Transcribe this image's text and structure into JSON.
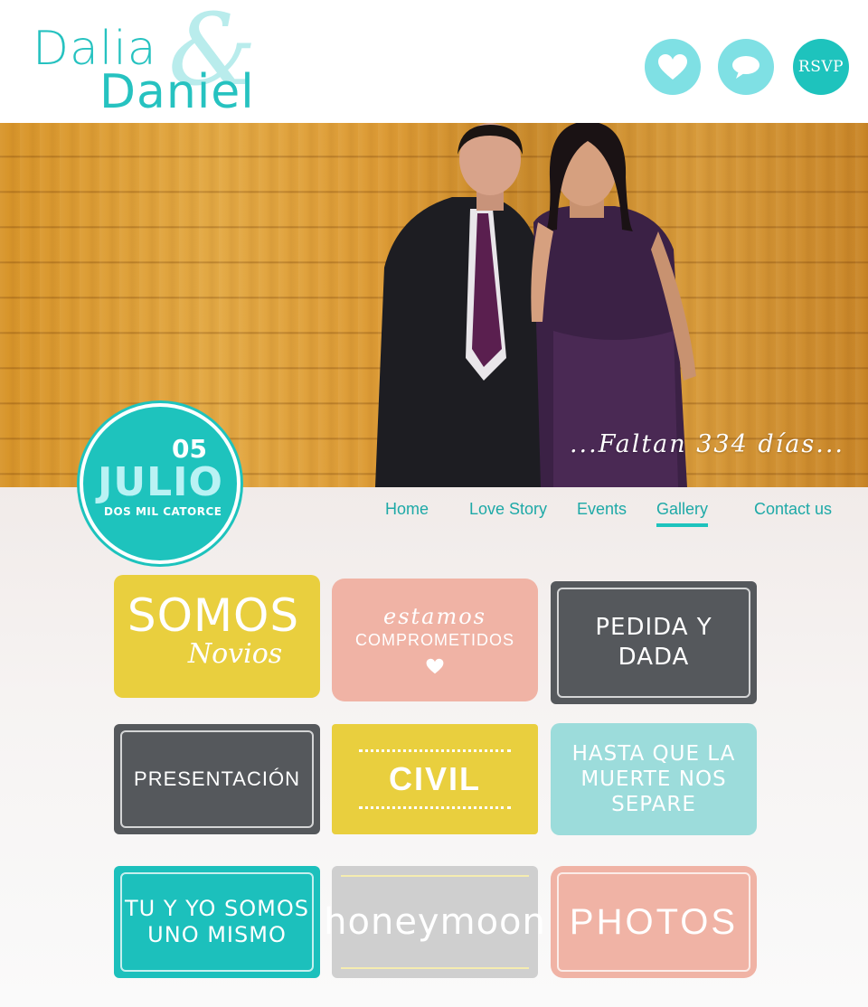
{
  "header": {
    "logo_line1": "Dalia",
    "logo_amp": "&",
    "logo_line2": "Daniel",
    "rsvp_label": "RSVP"
  },
  "hero": {
    "countdown": "...Faltan 334 días..."
  },
  "date_badge": {
    "day": "05",
    "month": "JULIO",
    "year": "DOS MIL CATORCE"
  },
  "nav": {
    "items": [
      "Home",
      "Love Story",
      "Events",
      "Gallery",
      "Contact us"
    ],
    "active": "Gallery"
  },
  "gallery": {
    "somos": "SOMOS",
    "novios": "Novios",
    "estamos": "estamos",
    "comprometidos": "COMPROMETIDOS",
    "pedida_1": "PEDIDA Y",
    "pedida_2": "DADA",
    "presentacion": "PRESENTACIÓN",
    "civil": "CIVIL",
    "hasta_1": "HASTA QUE LA",
    "hasta_2": "MUERTE NOS",
    "hasta_3": "SEPARE",
    "tu_1": "TU Y YO SOMOS",
    "tu_2": "UNO MISMO",
    "honeymoon": "honeymoon",
    "photos": "PHOTOS"
  },
  "colors": {
    "teal": "#1ec3bd",
    "light_teal": "#7fe0e4",
    "yellow": "#e9cf3e",
    "pink": "#f0b3a5",
    "gray": "#55585c",
    "aqua": "#9cdcdb",
    "silver": "#cfcfcf"
  },
  "icons": [
    "heart-icon",
    "chat-bubble-icon"
  ]
}
